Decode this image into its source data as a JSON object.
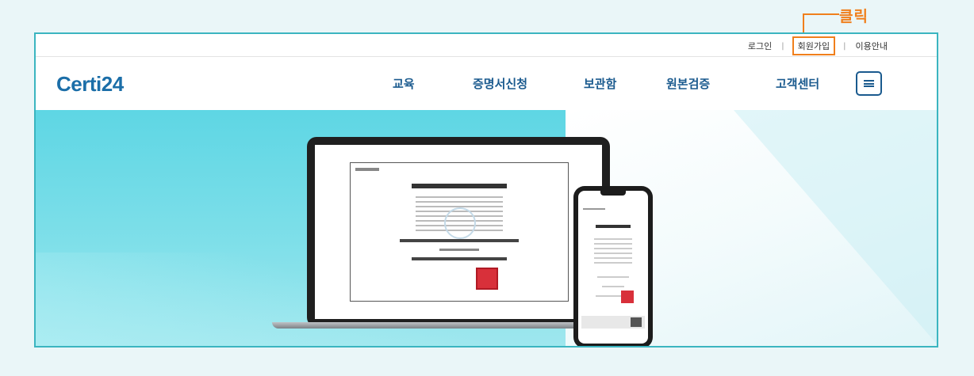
{
  "annotation": {
    "label": "클릭",
    "color": "#f07f1c"
  },
  "top_links": [
    {
      "label": "로그인"
    },
    {
      "label": "회원가입",
      "highlighted": true
    },
    {
      "label": "이용안내"
    }
  ],
  "top_links_separator": "|",
  "brand": {
    "logo": "Certi24",
    "color": "#1b6ea8"
  },
  "nav": {
    "menu": [
      {
        "label": "교육"
      },
      {
        "label": "증명서신청"
      },
      {
        "label": "보관함"
      },
      {
        "label": "원본검증"
      },
      {
        "label": "고객센터"
      }
    ],
    "menu_icon": "hamburger-menu-icon"
  },
  "colors": {
    "frame_border": "#3bb5c0",
    "nav_text": "#1a5a8e",
    "hero_accent": "#5ed6e4"
  }
}
